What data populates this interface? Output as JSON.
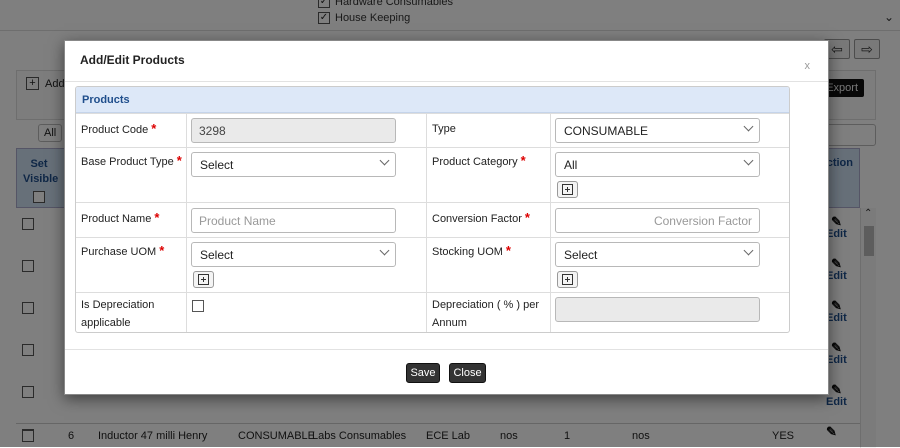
{
  "background": {
    "checkbox_items": [
      {
        "label": "Hardware Consumables",
        "checked": true
      },
      {
        "label": "House Keeping",
        "checked": true
      }
    ],
    "export_label": "Export",
    "add_label": "Add",
    "all_label": "All",
    "table_header": {
      "set_visible": "Set Visible",
      "action": "Action"
    },
    "edit_label": "Edit",
    "last_row": {
      "index": "6",
      "name": "Inductor 47 milli Henry",
      "type": "CONSUMABLE",
      "category": "Labs Consumables",
      "lab": "ECE Lab",
      "purchase_uom": "nos",
      "factor": "1",
      "stocking_uom": "nos",
      "flag": "YES"
    }
  },
  "modal": {
    "title": "Add/Edit Products",
    "close_x": "x",
    "section_title": "Products",
    "fields": {
      "product_code": {
        "label": "Product Code",
        "value": "3298"
      },
      "type": {
        "label": "Type",
        "value": "CONSUMABLE"
      },
      "base_product_type": {
        "label": "Base Product Type",
        "value": "Select"
      },
      "product_category": {
        "label": "Product Category",
        "value": "All"
      },
      "product_name": {
        "label": "Product Name",
        "placeholder": "Product Name"
      },
      "conversion_factor": {
        "label": "Conversion Factor",
        "placeholder": "Conversion Factor"
      },
      "purchase_uom": {
        "label": "Purchase UOM",
        "value": "Select"
      },
      "stocking_uom": {
        "label": "Stocking UOM",
        "value": "Select"
      },
      "is_depreciation": {
        "label": "Is Depreciation applicable",
        "checked": false
      },
      "depreciation_pct": {
        "label": "Depreciation ( % ) per Annum",
        "value": ""
      }
    },
    "required_mark": "*",
    "buttons": {
      "save": "Save",
      "close": "Close"
    }
  }
}
